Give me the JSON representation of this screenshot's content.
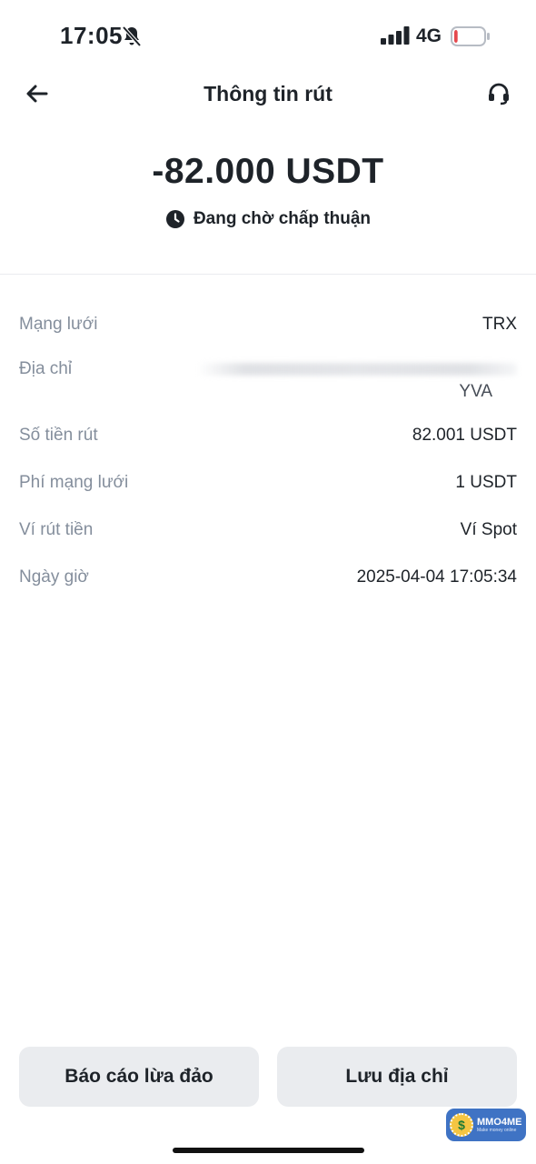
{
  "status_bar": {
    "time": "17:05",
    "network": "4G",
    "battery_level": 0.12,
    "battery_color": "#e5484d"
  },
  "header": {
    "title": "Thông tin rút",
    "back_icon": "arrow-left-icon",
    "support_icon": "headset-icon"
  },
  "summary": {
    "amount": "-82.000 USDT",
    "status": "Đang chờ chấp thuận",
    "status_icon": "clock-icon"
  },
  "details": [
    {
      "label": "Mạng lưới",
      "value": "TRX"
    },
    {
      "label": "Địa chỉ",
      "value": "YVA"
    },
    {
      "label": "Số tiền rút",
      "value": "82.001 USDT"
    },
    {
      "label": "Phí mạng lưới",
      "value": "1 USDT"
    },
    {
      "label": "Ví rút tiền",
      "value": "Ví Spot"
    },
    {
      "label": "Ngày giờ",
      "value": "2025-04-04 17:05:34"
    }
  ],
  "actions": {
    "report_label": "Báo cáo lừa đảo",
    "save_label": "Lưu địa chỉ"
  },
  "watermark": {
    "brand": "MMO4ME",
    "tagline": "Make money online"
  },
  "colors": {
    "text_primary": "#1e2329",
    "text_secondary": "#848e9c",
    "button_bg": "#eaecef"
  }
}
